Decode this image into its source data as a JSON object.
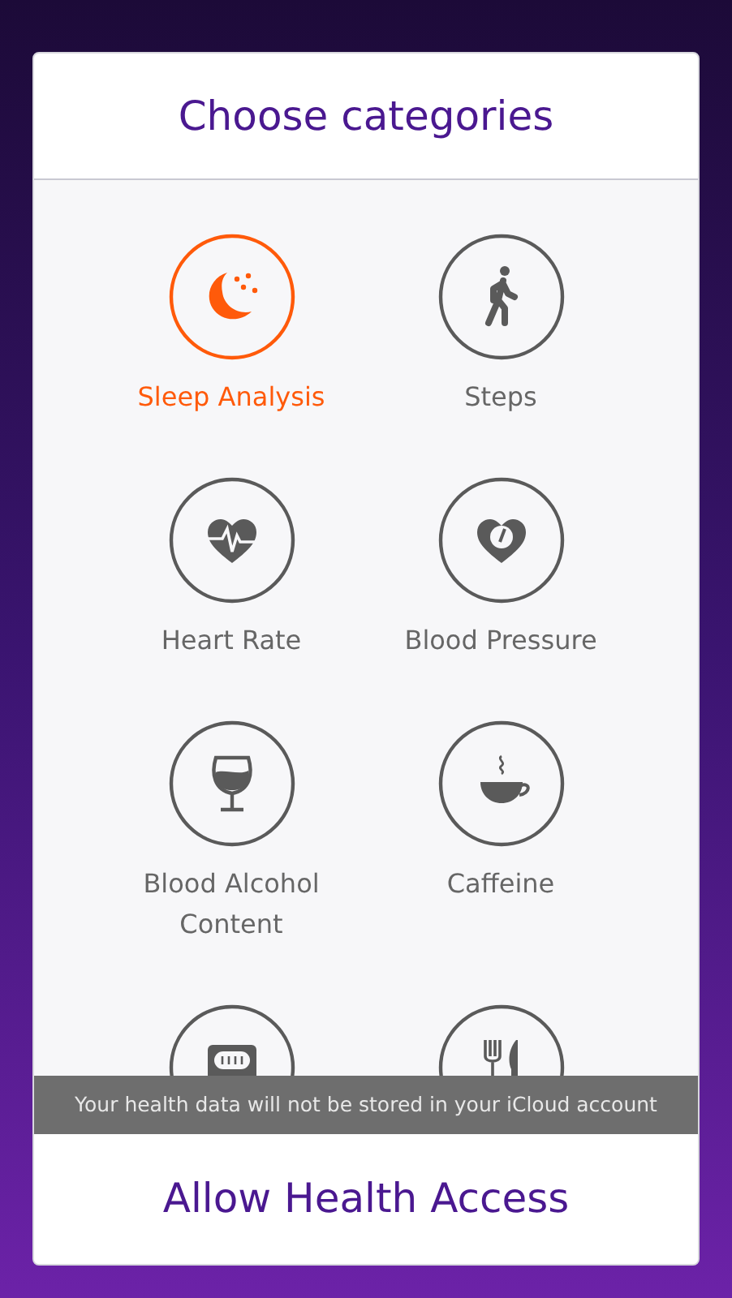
{
  "header": {
    "title": "Choose categories"
  },
  "categories": [
    {
      "label": "Sleep Analysis",
      "selected": true
    },
    {
      "label": "Steps",
      "selected": false
    },
    {
      "label": "Heart Rate",
      "selected": false
    },
    {
      "label": "Blood Pressure",
      "selected": false
    },
    {
      "label": "Blood Alcohol Content",
      "selected": false
    },
    {
      "label": "Caffeine",
      "selected": false
    },
    {
      "selected": false
    },
    {
      "selected": false
    }
  ],
  "notice": "Your health data will not be stored in your iCloud account",
  "footer": {
    "button": "Allow Health Access"
  }
}
